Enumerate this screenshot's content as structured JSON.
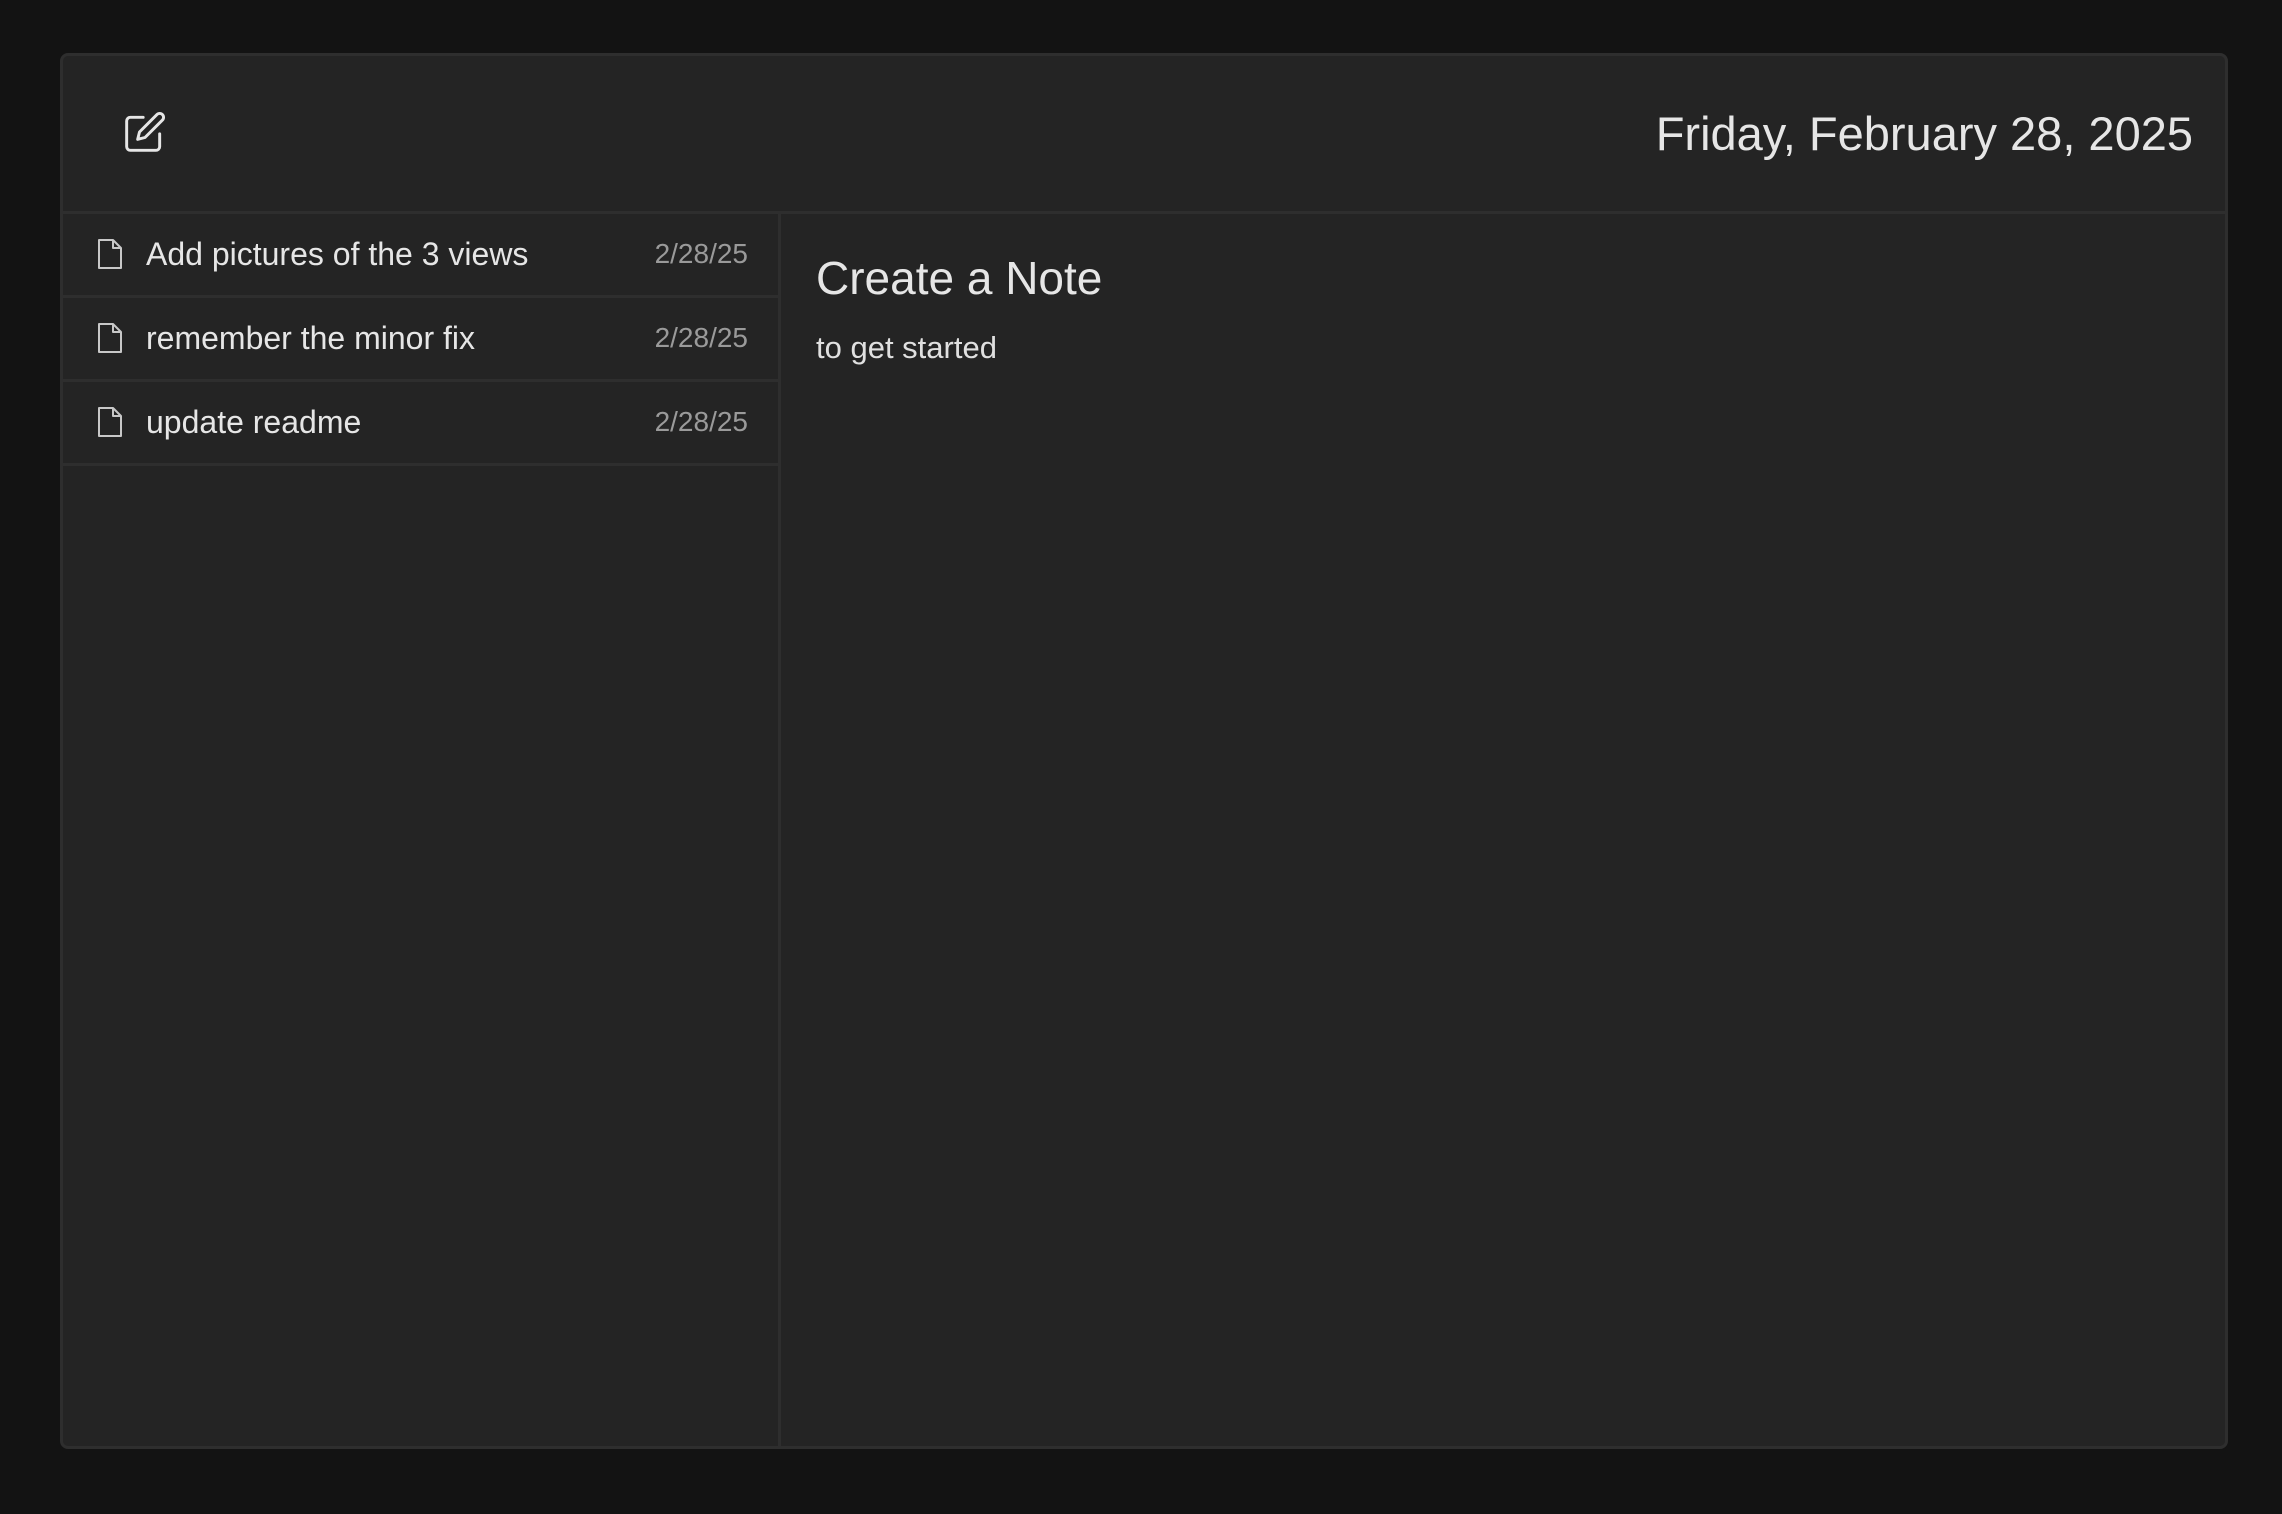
{
  "header": {
    "new_note_icon": "pencil-square-icon",
    "date": "Friday, February 28, 2025"
  },
  "notes": [
    {
      "title": "Add pictures of the 3 views",
      "date": "2/28/25",
      "icon": "document-icon"
    },
    {
      "title": "remember the minor fix",
      "date": "2/28/25",
      "icon": "document-icon"
    },
    {
      "title": "update readme",
      "date": "2/28/25",
      "icon": "document-icon"
    }
  ],
  "main": {
    "title": "Create a Note",
    "subtitle": "to get started"
  },
  "colors": {
    "background": "#131313",
    "panel": "#242424",
    "border": "#2e2e2e",
    "text": "#e6e6e6",
    "muted_text": "#9a9a9a"
  }
}
